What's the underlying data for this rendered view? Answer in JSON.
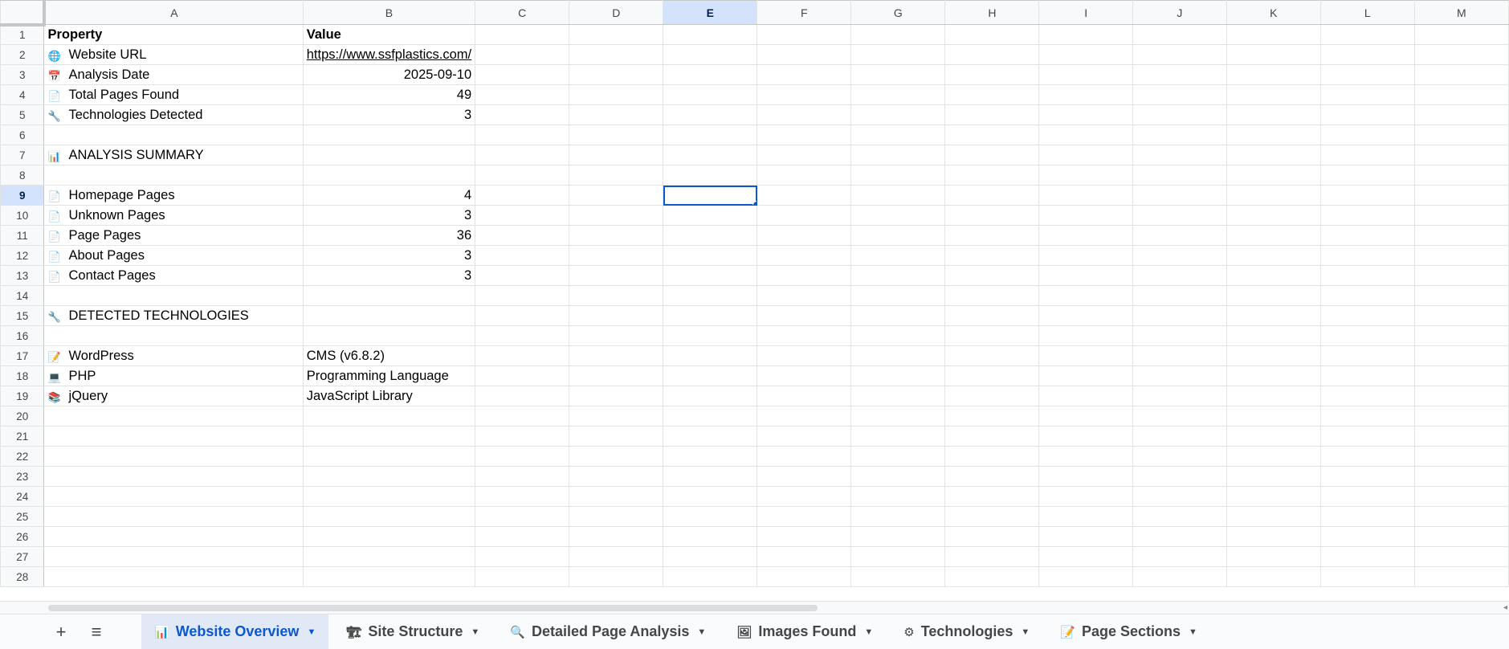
{
  "columns": [
    "A",
    "B",
    "C",
    "D",
    "E",
    "F",
    "G",
    "H",
    "I",
    "J",
    "K",
    "L",
    "M"
  ],
  "selected_column": "E",
  "selected_row": 9,
  "rows": [
    {
      "n": "1",
      "icon": "",
      "a": "Property",
      "b": "Value",
      "b_num": false
    },
    {
      "n": "2",
      "icon": "🌐",
      "a": "Website URL",
      "b": "https://www.ssfplastics.com/",
      "b_num": false,
      "b_link": true
    },
    {
      "n": "3",
      "icon": "📅",
      "a": "Analysis Date",
      "b": "2025-09-10",
      "b_num": true
    },
    {
      "n": "4",
      "icon": "📄",
      "a": "Total Pages Found",
      "b": "49",
      "b_num": true
    },
    {
      "n": "5",
      "icon": "🔧",
      "a": "Technologies Detected",
      "b": "3",
      "b_num": true
    },
    {
      "n": "6",
      "icon": "",
      "a": "",
      "b": ""
    },
    {
      "n": "7",
      "icon": "📊",
      "a": "ANALYSIS SUMMARY",
      "b": ""
    },
    {
      "n": "8",
      "icon": "",
      "a": "",
      "b": ""
    },
    {
      "n": "9",
      "icon": "📄",
      "a": "Homepage Pages",
      "b": "4",
      "b_num": true
    },
    {
      "n": "10",
      "icon": "📄",
      "a": "Unknown Pages",
      "b": "3",
      "b_num": true
    },
    {
      "n": "11",
      "icon": "📄",
      "a": "Page Pages",
      "b": "36",
      "b_num": true
    },
    {
      "n": "12",
      "icon": "📄",
      "a": "About Pages",
      "b": "3",
      "b_num": true
    },
    {
      "n": "13",
      "icon": "📄",
      "a": "Contact Pages",
      "b": "3",
      "b_num": true
    },
    {
      "n": "14",
      "icon": "",
      "a": "",
      "b": ""
    },
    {
      "n": "15",
      "icon": "🔧",
      "a": "DETECTED TECHNOLOGIES",
      "b": ""
    },
    {
      "n": "16",
      "icon": "",
      "a": "",
      "b": ""
    },
    {
      "n": "17",
      "icon": "📝",
      "a": "WordPress",
      "b": "CMS (v6.8.2)",
      "b_num": false
    },
    {
      "n": "18",
      "icon": "💻",
      "a": "PHP",
      "b": "Programming Language",
      "b_num": false
    },
    {
      "n": "19",
      "icon": "📚",
      "a": "jQuery",
      "b": "JavaScript Library",
      "b_num": false
    },
    {
      "n": "20",
      "icon": "",
      "a": "",
      "b": ""
    },
    {
      "n": "21",
      "icon": "",
      "a": "",
      "b": ""
    },
    {
      "n": "22",
      "icon": "",
      "a": "",
      "b": ""
    },
    {
      "n": "23",
      "icon": "",
      "a": "",
      "b": ""
    },
    {
      "n": "24",
      "icon": "",
      "a": "",
      "b": ""
    },
    {
      "n": "25",
      "icon": "",
      "a": "",
      "b": ""
    },
    {
      "n": "26",
      "icon": "",
      "a": "",
      "b": ""
    },
    {
      "n": "27",
      "icon": "",
      "a": "",
      "b": ""
    },
    {
      "n": "28",
      "icon": "",
      "a": "",
      "b": ""
    }
  ],
  "toolbar": {
    "add_icon": "+",
    "menu_icon": "≡"
  },
  "sheet_tabs": [
    {
      "icon": "📊",
      "label": "Website Overview",
      "active": true
    },
    {
      "icon": "🏗",
      "label": "Site Structure",
      "active": false
    },
    {
      "icon": "🔍",
      "label": "Detailed Page Analysis",
      "active": false
    },
    {
      "icon": "🖼",
      "label": "Images Found",
      "active": false
    },
    {
      "icon": "⚙",
      "label": "Technologies",
      "active": false
    },
    {
      "icon": "📝",
      "label": "Page Sections",
      "active": false
    }
  ],
  "colors": {
    "accent": "#0b57d0",
    "link": "#1155cc",
    "header_bg": "#f8f9fa",
    "selected_header_bg": "#d3e3fd"
  }
}
